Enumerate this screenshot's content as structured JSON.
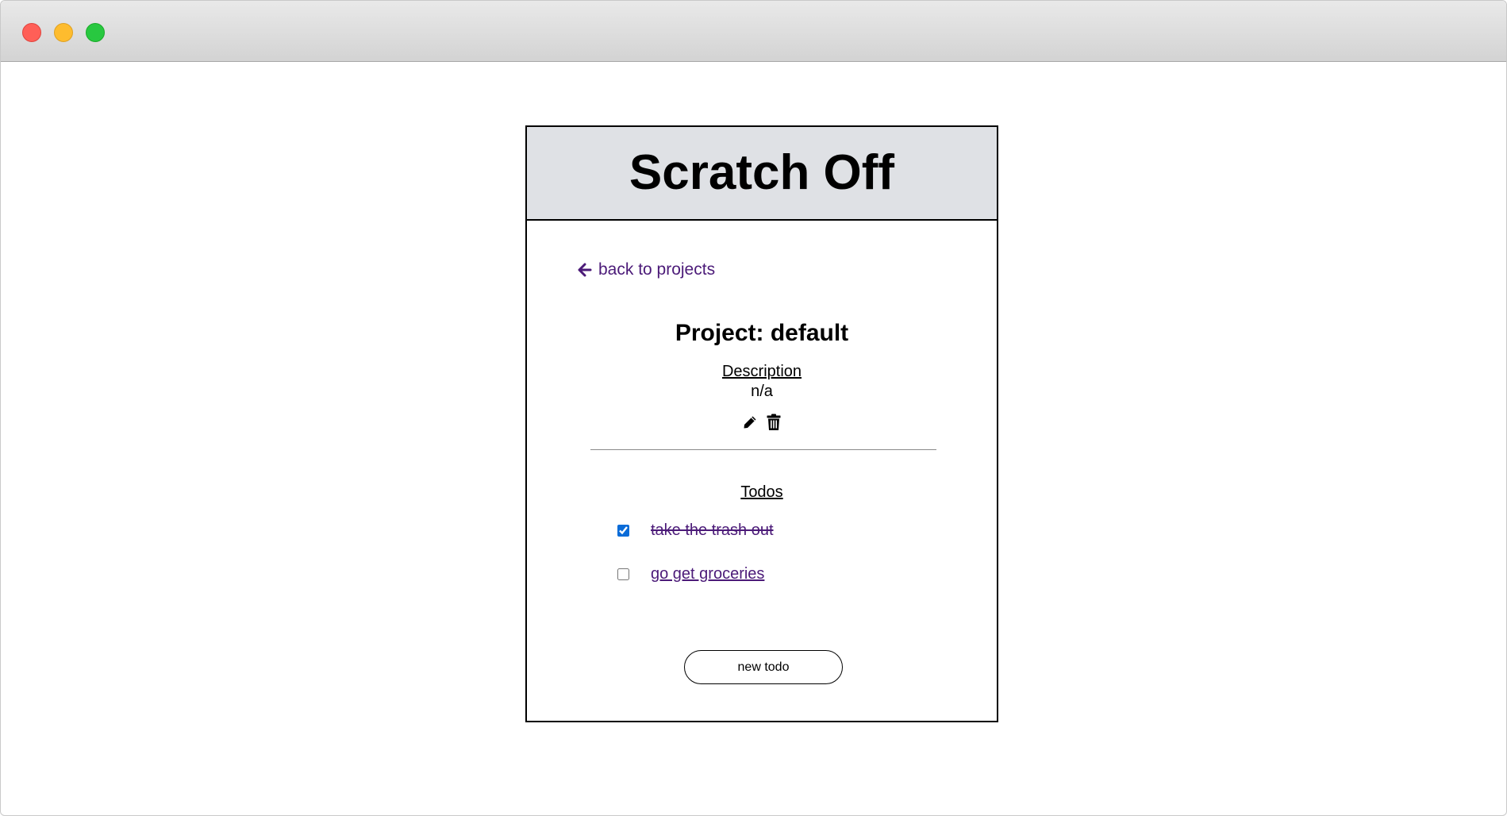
{
  "app": {
    "title": "Scratch Off"
  },
  "nav": {
    "back_label": "back to projects",
    "back_icon": "arrow-left-icon"
  },
  "project": {
    "title": "Project: default",
    "description_heading": "Description",
    "description_value": "n/a",
    "edit_icon": "pencil-icon",
    "delete_icon": "trash-icon"
  },
  "todos": {
    "heading": "Todos",
    "items": [
      {
        "label": "take the trash out",
        "checked": true
      },
      {
        "label": "go get groceries",
        "checked": false
      }
    ],
    "new_button_label": "new todo"
  },
  "colors": {
    "link": "#4b1a78",
    "header_bg": "#dfe1e5",
    "checkbox_accent": "#0b6cd8"
  }
}
